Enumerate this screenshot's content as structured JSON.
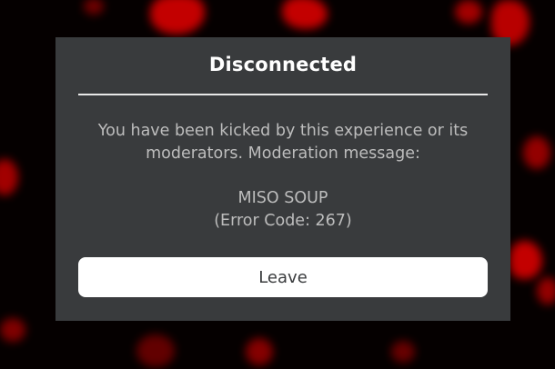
{
  "dialog": {
    "title": "Disconnected",
    "message": "You have been kicked by this experience or its moderators. Moderation message:",
    "moderation_text": "MISO SOUP",
    "error_code": "(Error Code: 267)",
    "leave_label": "Leave"
  },
  "colors": {
    "dialog_background": "#393b3d",
    "button_background": "#ffffff",
    "backdrop_accent": "#d40000"
  }
}
